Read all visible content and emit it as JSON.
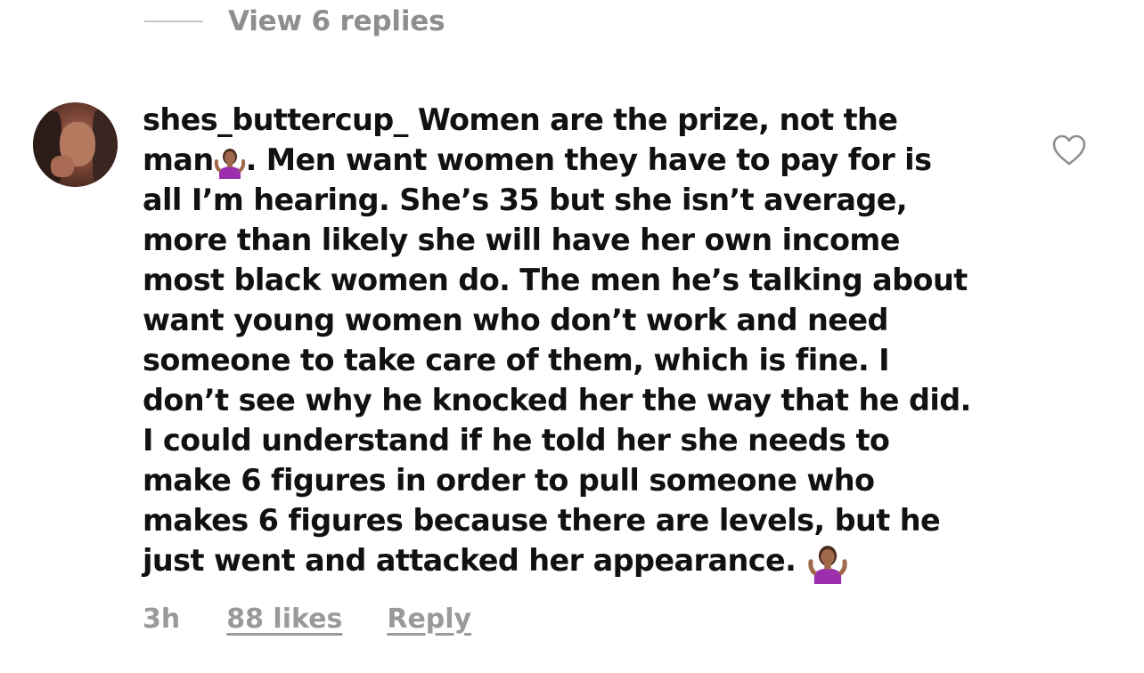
{
  "replies": {
    "view_label": "View 6 replies"
  },
  "comment": {
    "username": "shes_buttercup_",
    "line1_rest": "Women are the prize, not the",
    "line2_start": "man",
    "line2_end": ". Men want women they have to pay for is",
    "lines": [
      "all I’m hearing. She’s 35 but she isn’t average,",
      "more than likely she will have her own income",
      "most black women do. The men he’s talking about",
      "want young women who don’t work and need",
      "someone to take care of them, which is fine. I",
      "don’t see why he knocked her the way that he did.",
      "I could understand if he told her she needs to",
      "make 6 figures in order to pull someone who",
      "makes 6 figures because there are levels, but he"
    ],
    "last_line": "just went and attacked her appearance.",
    "emoji_name": "person-shrugging-emoji"
  },
  "footer": {
    "time": "3h",
    "likes": "88 likes",
    "reply": "Reply"
  },
  "icons": {
    "like": "heart-outline-icon"
  },
  "colors": {
    "text": "#111111",
    "muted": "#8e8e8e",
    "emoji_shirt": "#9b2fae",
    "emoji_skin": "#a0694b"
  }
}
